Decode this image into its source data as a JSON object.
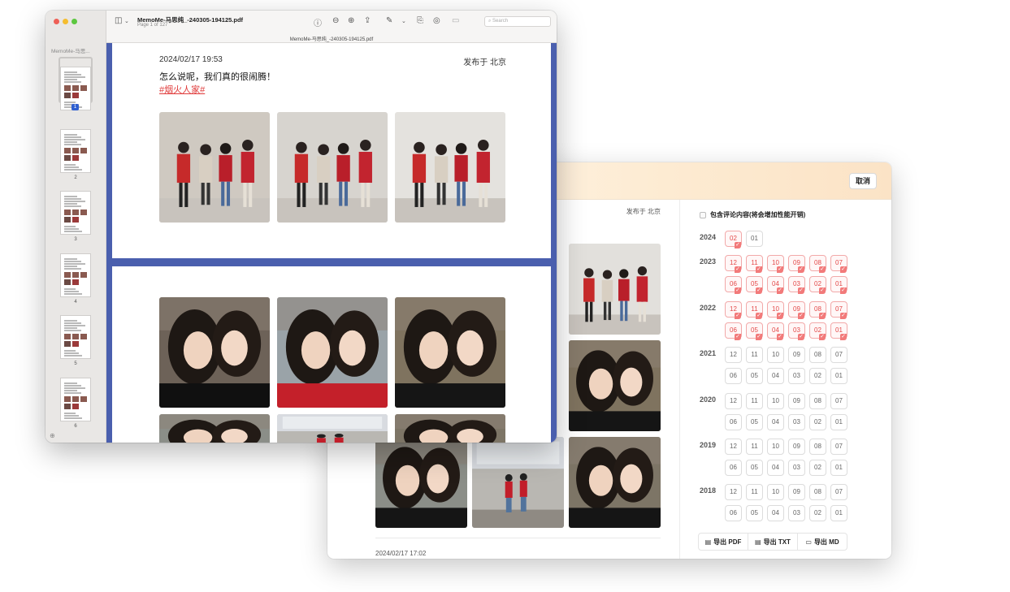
{
  "preview": {
    "doc_title": "MemoMe-马思纯_-240305-194125.pdf",
    "doc_page": "Page 1 of 127",
    "doc_filename": "MemoMe-马思纯_-240305-194125.pdf",
    "sidebar_title": "MemoMe-马思...",
    "search_placeholder": "Search",
    "thumb_numbers": [
      "1",
      "2",
      "3",
      "4",
      "5",
      "6"
    ],
    "post": {
      "date": "2024/02/17 19:53",
      "location": "发布于 北京",
      "text": "怎么说呢，我们真的很闹腾！",
      "tag": "#烟火人家#"
    }
  },
  "exporter": {
    "cancel_label": "取消",
    "location": "发布于 北京",
    "next_post_date": "2024/02/17 17:02",
    "comment_option_label": "包含评论内容(将会增加性能开销)",
    "years": [
      {
        "year": "2024",
        "months": [
          {
            "m": "02",
            "selected": true
          },
          {
            "m": "01",
            "selected": false
          }
        ]
      },
      {
        "year": "2023",
        "months": [
          {
            "m": "12",
            "selected": true
          },
          {
            "m": "11",
            "selected": true
          },
          {
            "m": "10",
            "selected": true
          },
          {
            "m": "09",
            "selected": true
          },
          {
            "m": "08",
            "selected": true
          },
          {
            "m": "07",
            "selected": true
          },
          {
            "m": "06",
            "selected": true
          },
          {
            "m": "05",
            "selected": true
          },
          {
            "m": "04",
            "selected": true
          },
          {
            "m": "03",
            "selected": true
          },
          {
            "m": "02",
            "selected": true
          },
          {
            "m": "01",
            "selected": true
          }
        ]
      },
      {
        "year": "2022",
        "months": [
          {
            "m": "12",
            "selected": true
          },
          {
            "m": "11",
            "selected": true
          },
          {
            "m": "10",
            "selected": true
          },
          {
            "m": "09",
            "selected": true
          },
          {
            "m": "08",
            "selected": true
          },
          {
            "m": "07",
            "selected": true
          },
          {
            "m": "06",
            "selected": true
          },
          {
            "m": "05",
            "selected": true
          },
          {
            "m": "04",
            "selected": true
          },
          {
            "m": "03",
            "selected": true
          },
          {
            "m": "02",
            "selected": true
          },
          {
            "m": "01",
            "selected": true
          }
        ]
      },
      {
        "year": "2021",
        "months": [
          {
            "m": "12",
            "selected": false
          },
          {
            "m": "11",
            "selected": false
          },
          {
            "m": "10",
            "selected": false
          },
          {
            "m": "09",
            "selected": false
          },
          {
            "m": "08",
            "selected": false
          },
          {
            "m": "07",
            "selected": false
          },
          {
            "m": "06",
            "selected": false
          },
          {
            "m": "05",
            "selected": false
          },
          {
            "m": "04",
            "selected": false
          },
          {
            "m": "03",
            "selected": false
          },
          {
            "m": "02",
            "selected": false
          },
          {
            "m": "01",
            "selected": false
          }
        ]
      },
      {
        "year": "2020",
        "months": [
          {
            "m": "12",
            "selected": false
          },
          {
            "m": "11",
            "selected": false
          },
          {
            "m": "10",
            "selected": false
          },
          {
            "m": "09",
            "selected": false
          },
          {
            "m": "08",
            "selected": false
          },
          {
            "m": "07",
            "selected": false
          },
          {
            "m": "06",
            "selected": false
          },
          {
            "m": "05",
            "selected": false
          },
          {
            "m": "04",
            "selected": false
          },
          {
            "m": "03",
            "selected": false
          },
          {
            "m": "02",
            "selected": false
          },
          {
            "m": "01",
            "selected": false
          }
        ]
      },
      {
        "year": "2019",
        "months": [
          {
            "m": "12",
            "selected": false
          },
          {
            "m": "11",
            "selected": false
          },
          {
            "m": "10",
            "selected": false
          },
          {
            "m": "09",
            "selected": false
          },
          {
            "m": "08",
            "selected": false
          },
          {
            "m": "07",
            "selected": false
          },
          {
            "m": "06",
            "selected": false
          },
          {
            "m": "05",
            "selected": false
          },
          {
            "m": "04",
            "selected": false
          },
          {
            "m": "03",
            "selected": false
          },
          {
            "m": "02",
            "selected": false
          },
          {
            "m": "01",
            "selected": false
          }
        ]
      },
      {
        "year": "2018",
        "months": [
          {
            "m": "12",
            "selected": false
          },
          {
            "m": "11",
            "selected": false
          },
          {
            "m": "10",
            "selected": false
          },
          {
            "m": "09",
            "selected": false
          },
          {
            "m": "08",
            "selected": false
          },
          {
            "m": "07",
            "selected": false
          },
          {
            "m": "06",
            "selected": false
          },
          {
            "m": "05",
            "selected": false
          },
          {
            "m": "04",
            "selected": false
          },
          {
            "m": "03",
            "selected": false
          },
          {
            "m": "02",
            "selected": false
          },
          {
            "m": "01",
            "selected": false
          }
        ]
      }
    ],
    "export_buttons": [
      {
        "label": "导出 PDF",
        "icon": "file-icon"
      },
      {
        "label": "导出 TXT",
        "icon": "file-text-icon"
      },
      {
        "label": "导出 MD",
        "icon": "markdown-icon"
      }
    ]
  },
  "colors": {
    "preview_background": "#4a5fae",
    "selected_month": "#e34a4a",
    "header_gradient": "#fdebd2",
    "tag_red": "#e03b3b"
  }
}
